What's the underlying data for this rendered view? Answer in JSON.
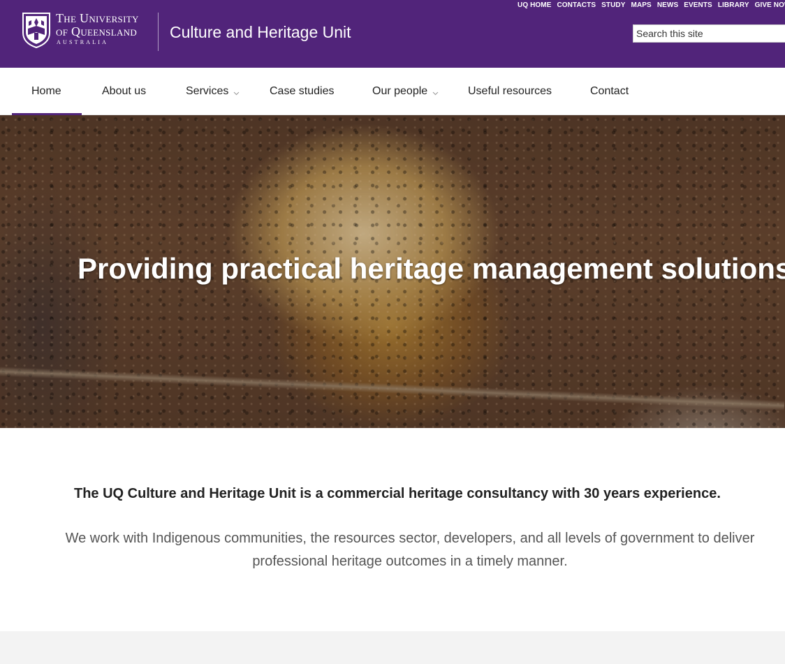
{
  "utility_nav": [
    "UQ HOME",
    "CONTACTS",
    "STUDY",
    "MAPS",
    "NEWS",
    "EVENTS",
    "LIBRARY",
    "GIVE NOW"
  ],
  "logo": {
    "line1": "The University",
    "line2": "of Queensland",
    "line3": "AUSTRALIA"
  },
  "site_title": "Culture and Heritage Unit",
  "search": {
    "placeholder": "Search this site"
  },
  "nav": {
    "items": [
      {
        "label": "Home",
        "active": true,
        "dropdown": false
      },
      {
        "label": "About us",
        "active": false,
        "dropdown": false
      },
      {
        "label": "Services",
        "active": false,
        "dropdown": true
      },
      {
        "label": "Case studies",
        "active": false,
        "dropdown": false
      },
      {
        "label": "Our people",
        "active": false,
        "dropdown": true
      },
      {
        "label": "Useful resources",
        "active": false,
        "dropdown": false
      },
      {
        "label": "Contact",
        "active": false,
        "dropdown": false
      }
    ]
  },
  "hero": {
    "title": "Providing practical heritage management solutions"
  },
  "intro": {
    "lead": "The UQ Culture and Heritage Unit is a commercial heritage consultancy with 30 years experience.",
    "body": "We work with Indigenous communities, the resources sector, developers, and all levels of government to deliver professional heritage outcomes in a timely manner."
  },
  "colors": {
    "brand_purple": "#51247a",
    "footer_band": "#f3f3f3"
  }
}
